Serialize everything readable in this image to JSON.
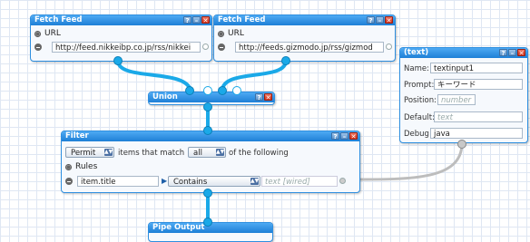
{
  "fetch1": {
    "title": "Fetch Feed",
    "url_label": "URL",
    "url_value": "http://feed.nikkeibp.co.jp/rss/nikkei"
  },
  "fetch2": {
    "title": "Fetch Feed",
    "url_label": "URL",
    "url_value": "http://feeds.gizmodo.jp/rss/gizmod"
  },
  "union": {
    "title": "Union"
  },
  "text": {
    "title": "(text)",
    "name_label": "Name:",
    "name_value": "textinput1",
    "prompt_label": "Prompt:",
    "prompt_value": "キーワード",
    "position_label": "Position:",
    "position_placeholder": "number",
    "default_label": "Default:",
    "default_placeholder": "text",
    "debug_label": "Debug:",
    "debug_value": "java"
  },
  "filter": {
    "title": "Filter",
    "mode": "Permit",
    "items_text": "items that match",
    "match": "all",
    "of_text": "of the following",
    "rules_label": "Rules",
    "rule_field": "item.title",
    "rule_op": "Contains",
    "rule_value": "text [wired]"
  },
  "output": {
    "title": "Pipe Output"
  },
  "controls": {
    "help": "?",
    "min": "–",
    "close": "✕"
  },
  "colors": {
    "accent": "#1e7fd6",
    "wire": "#1aa9e8",
    "close": "#cf2d18"
  }
}
